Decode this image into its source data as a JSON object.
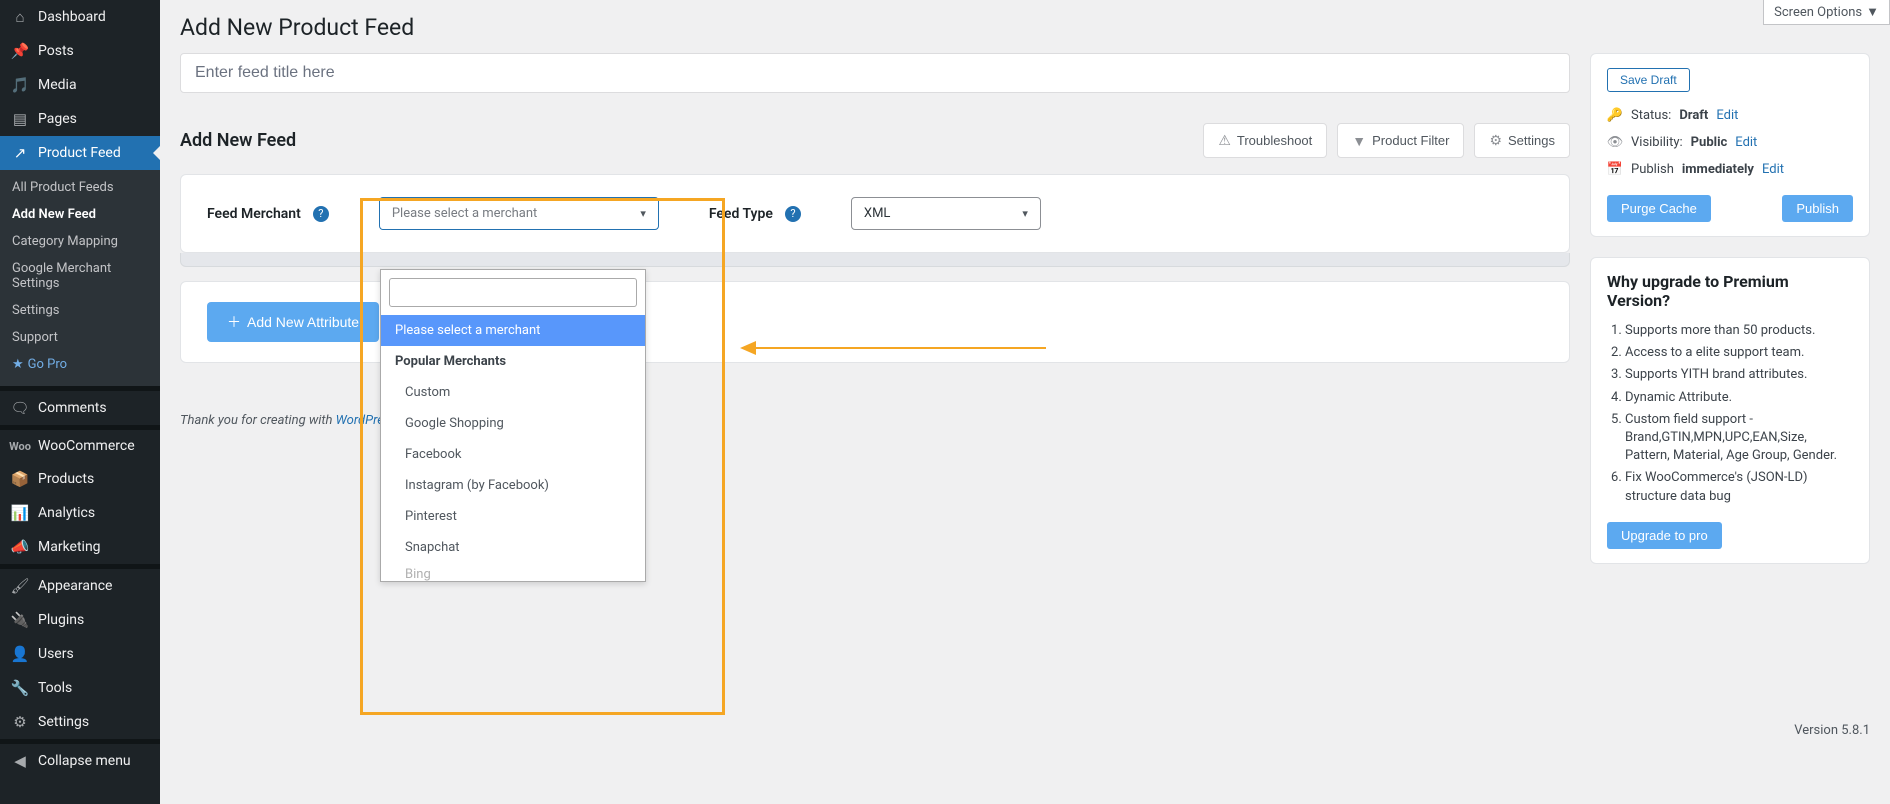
{
  "header": {
    "page_title": "Add New Product Feed",
    "screen_options": "Screen Options",
    "title_placeholder": "Enter feed title here",
    "section_title": "Add New Feed",
    "footer_text": "Thank you for creating with ",
    "footer_link": "WordPress",
    "version": "Version 5.8.1"
  },
  "sidebar": {
    "items": [
      {
        "label": "Dashboard",
        "icon": "⌂"
      },
      {
        "label": "Posts",
        "icon": "✎"
      },
      {
        "label": "Media",
        "icon": "🖼"
      },
      {
        "label": "Pages",
        "icon": "▤"
      },
      {
        "label": "Product Feed",
        "icon": "↗"
      },
      {
        "label": "Comments",
        "icon": "💬"
      },
      {
        "label": "WooCommerce",
        "icon": "W"
      },
      {
        "label": "Products",
        "icon": "📦"
      },
      {
        "label": "Analytics",
        "icon": "📊"
      },
      {
        "label": "Marketing",
        "icon": "📣"
      },
      {
        "label": "Appearance",
        "icon": "🖌"
      },
      {
        "label": "Plugins",
        "icon": "🔌"
      },
      {
        "label": "Users",
        "icon": "👤"
      },
      {
        "label": "Tools",
        "icon": "🔧"
      },
      {
        "label": "Settings",
        "icon": "⚙"
      },
      {
        "label": "Collapse menu",
        "icon": "◀"
      }
    ],
    "submenu": [
      {
        "label": "All Product Feeds"
      },
      {
        "label": "Add New Feed"
      },
      {
        "label": "Category Mapping"
      },
      {
        "label": "Google Merchant Settings"
      },
      {
        "label": "Settings"
      },
      {
        "label": "Support"
      },
      {
        "label": "Go Pro"
      }
    ]
  },
  "actions": {
    "troubleshoot": "Troubleshoot",
    "product_filter": "Product Filter",
    "settings": "Settings",
    "add_attribute": "Add New Attribute"
  },
  "form": {
    "feed_merchant_label": "Feed Merchant",
    "feed_merchant_placeholder": "Please select a merchant",
    "feed_type_label": "Feed Type",
    "feed_type_value": "XML"
  },
  "dropdown": {
    "placeholder_option": "Please select a merchant",
    "group_heading": "Popular Merchants",
    "options": [
      "Custom",
      "Google Shopping",
      "Facebook",
      "Instagram (by Facebook)",
      "Pinterest",
      "Snapchat"
    ],
    "partial_option": "Bing"
  },
  "publish": {
    "save_draft": "Save Draft",
    "status_label": "Status:",
    "status_value": "Draft",
    "visibility_label": "Visibility:",
    "visibility_value": "Public",
    "publish_label": "Publish",
    "publish_value": "immediately",
    "edit": "Edit",
    "purge_cache": "Purge Cache",
    "publish_btn": "Publish"
  },
  "upgrade": {
    "heading": "Why upgrade to Premium Version?",
    "items": [
      "Supports more than 50 products.",
      "Access to a elite support team.",
      "Supports YITH brand attributes.",
      "Dynamic Attribute.",
      "Custom field support - Brand,GTIN,MPN,UPC,EAN,Size, Pattern, Material, Age Group, Gender.",
      "Fix WooCommerce's (JSON-LD) structure data bug"
    ],
    "button": "Upgrade to pro"
  }
}
